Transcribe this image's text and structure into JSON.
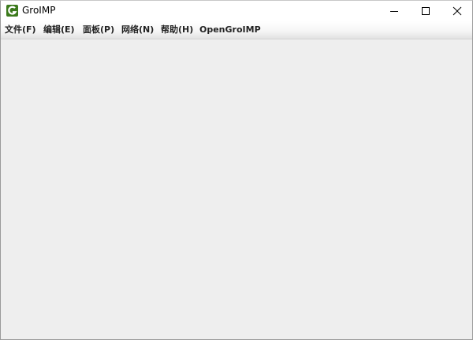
{
  "window": {
    "title": "GroIMP",
    "icon": "groimp-logo-icon",
    "controls": [
      "minimize-icon",
      "maximize-icon",
      "close-icon"
    ]
  },
  "menubar": {
    "items": [
      {
        "label": "文件(F)"
      },
      {
        "label": "编辑(E)"
      },
      {
        "label": "面板(P)"
      },
      {
        "label": "网络(N)"
      },
      {
        "label": "帮助(H)"
      },
      {
        "label": "OpenGroIMP"
      }
    ]
  },
  "colors": {
    "icon_green": "#3c7a1c",
    "content_bg": "#eeeeee"
  }
}
